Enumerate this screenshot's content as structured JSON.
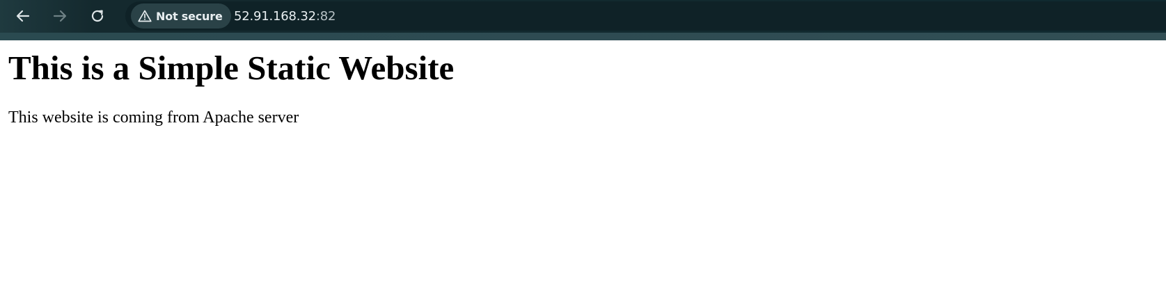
{
  "browser": {
    "security_label": "Not secure",
    "url_host": "52.91.168.32",
    "url_port": ":82",
    "icons": {
      "back": "back-arrow-icon",
      "forward": "forward-arrow-icon",
      "reload": "reload-icon",
      "security": "warning-triangle-icon"
    },
    "colors": {
      "toolbar": "#14292e",
      "chip": "#2a4247",
      "text": "#e8eef0"
    }
  },
  "page": {
    "heading": "This is a Simple Static Website",
    "paragraph": "This website is coming from Apache server"
  }
}
